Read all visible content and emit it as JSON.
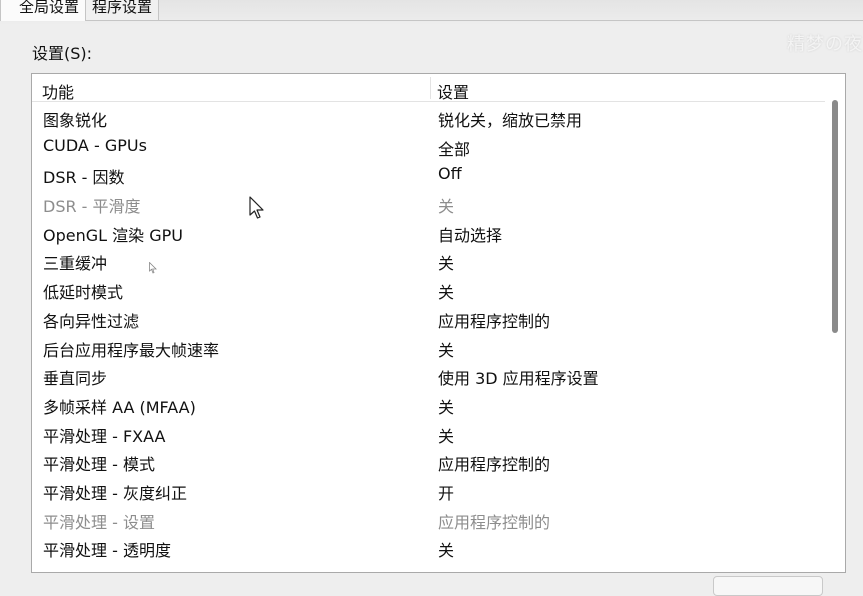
{
  "tabs": [
    {
      "label": "全局设置",
      "active": true
    },
    {
      "label": "程序设置",
      "active": false
    }
  ],
  "watermark": "精梦の夜",
  "settings_label": "设置(S):",
  "table": {
    "headers": [
      "功能",
      "设置"
    ],
    "rows": [
      {
        "feature": "图象锐化",
        "value": "锐化关，缩放已禁用",
        "disabled": false
      },
      {
        "feature": "CUDA - GPUs",
        "value": "全部",
        "disabled": false
      },
      {
        "feature": "DSR - 因数",
        "value": "Off",
        "disabled": false
      },
      {
        "feature": "DSR - 平滑度",
        "value": "关",
        "disabled": true
      },
      {
        "feature": "OpenGL 渲染 GPU",
        "value": "自动选择",
        "disabled": false
      },
      {
        "feature": "三重缓冲",
        "value": "关",
        "disabled": false
      },
      {
        "feature": "低延时模式",
        "value": "关",
        "disabled": false
      },
      {
        "feature": "各向异性过滤",
        "value": "应用程序控制的",
        "disabled": false
      },
      {
        "feature": "后台应用程序最大帧速率",
        "value": "关",
        "disabled": false
      },
      {
        "feature": "垂直同步",
        "value": "使用 3D 应用程序设置",
        "disabled": false
      },
      {
        "feature": "多帧采样 AA (MFAA)",
        "value": "关",
        "disabled": false
      },
      {
        "feature": "平滑处理 - FXAA",
        "value": "关",
        "disabled": false
      },
      {
        "feature": "平滑处理 - 模式",
        "value": "应用程序控制的",
        "disabled": false
      },
      {
        "feature": "平滑处理 - 灰度纠正",
        "value": "开",
        "disabled": false
      },
      {
        "feature": "平滑处理 - 设置",
        "value": "应用程序控制的",
        "disabled": true
      },
      {
        "feature": "平滑处理 - 透明度",
        "value": "关",
        "disabled": false
      }
    ]
  },
  "icons": {
    "cursor": "mouse-pointer-icon"
  }
}
